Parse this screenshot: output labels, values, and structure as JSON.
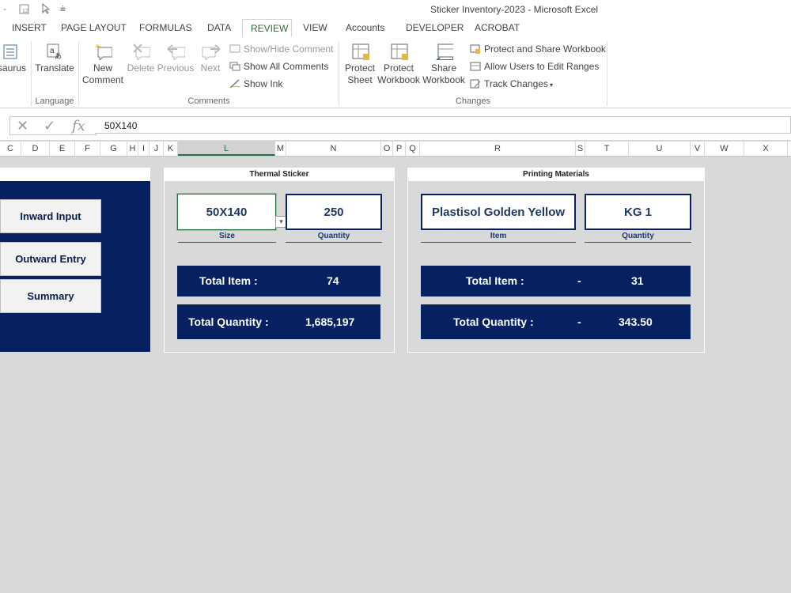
{
  "window": {
    "title": "Sticker Inventory-2023 - Microsoft Excel"
  },
  "ribbon_tabs": [
    "INSERT",
    "PAGE LAYOUT",
    "FORMULAS",
    "DATA",
    "REVIEW",
    "VIEW",
    "Accounts",
    "DEVELOPER",
    "ACROBAT"
  ],
  "active_tab": "REVIEW",
  "ribbon": {
    "thesaurus": "saurus",
    "translate": "Translate",
    "language_group": "Language",
    "new_comment": [
      "New",
      "Comment"
    ],
    "delete": "Delete",
    "previous": "Previous",
    "next": "Next",
    "show_hide_comment": "Show/Hide Comment",
    "show_all_comments": "Show All Comments",
    "show_ink": "Show Ink",
    "comments_group": "Comments",
    "protect_sheet": [
      "Protect",
      "Sheet"
    ],
    "protect_workbook": [
      "Protect",
      "Workbook"
    ],
    "share_workbook": [
      "Share",
      "Workbook"
    ],
    "protect_and_share": "Protect and Share Workbook",
    "allow_users": "Allow Users to Edit Ranges",
    "track_changes": "Track Changes",
    "changes_group": "Changes"
  },
  "formula_bar": {
    "fx": "fx",
    "value": "50X140"
  },
  "columns": [
    "C",
    "D",
    "E",
    "F",
    "G",
    "H",
    "I",
    "J",
    "K",
    "L",
    "M",
    "N",
    "O",
    "P",
    "Q",
    "R",
    "S",
    "T",
    "U",
    "V",
    "W",
    "X"
  ],
  "selected_column": "L",
  "nav_buttons": [
    "Inward Input",
    "Outward Entry",
    "Summary"
  ],
  "thermal": {
    "header": "Thermal Sticker",
    "size_value": "50X140",
    "size_label": "Size",
    "qty_value": "250",
    "qty_label": "Quantity",
    "total_item_label": "Total Item :",
    "total_item_value": "74",
    "total_qty_label": "Total Quantity :",
    "total_qty_value": "1,685,197"
  },
  "printing": {
    "header": "Printing Materials",
    "item_value": "Plastisol Golden Yellow",
    "item_label": "Item",
    "qty_value": "KG  1",
    "qty_label": "Quantity",
    "total_item_label": "Total Item :",
    "total_item_dash": "-",
    "total_item_value": "31",
    "total_qty_label": "Total Quantity :",
    "total_qty_dash": "-",
    "total_qty_value": "343.50"
  },
  "colors": {
    "navy": "#052162",
    "excel_green": "#217346",
    "grid_gray": "#d9d9d9"
  }
}
